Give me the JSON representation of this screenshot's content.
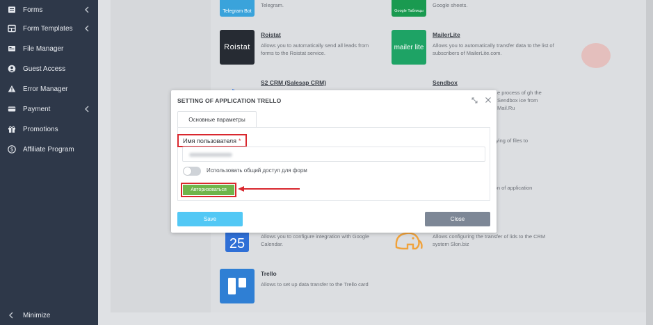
{
  "sidebar": {
    "items": [
      {
        "label": "Forms",
        "icon": "forms-icon",
        "has_submenu": true
      },
      {
        "label": "Form Templates",
        "icon": "templates-icon",
        "has_submenu": true
      },
      {
        "label": "File Manager",
        "icon": "file-manager-icon",
        "has_submenu": false
      },
      {
        "label": "Guest Access",
        "icon": "user-circle-icon",
        "has_submenu": false
      },
      {
        "label": "Error Manager",
        "icon": "warning-icon",
        "has_submenu": false
      },
      {
        "label": "Payment",
        "icon": "payment-icon",
        "has_submenu": true
      },
      {
        "label": "Promotions",
        "icon": "gift-icon",
        "has_submenu": false
      },
      {
        "label": "Affiliate Program",
        "icon": "dollar-icon",
        "has_submenu": false
      }
    ],
    "minimize_label": "Minimize"
  },
  "apps": [
    {
      "name": "",
      "logo_text": "Telegram Bot",
      "desc": "Telegram."
    },
    {
      "name": "",
      "logo_text": "Google Таблицы",
      "desc": "Google sheets."
    },
    {
      "name": "Roistat",
      "logo_text": "Roistat",
      "desc": "Allows you to automatically send all leads from forms to the Roistat service."
    },
    {
      "name": "MailerLite",
      "logo_text": "mailer lite",
      "desc": "Allows you to automatically transfer data to the list of subscribers of MailerLite.com."
    },
    {
      "name": "S2 CRM (Salesap CRM)",
      "logo_text": "",
      "desc": ""
    },
    {
      "name": "Sendbox",
      "logo_text": "",
      "desc": "e process of gh the Sendbox ice from Mail.Ru"
    },
    {
      "name": "",
      "logo_text": "",
      "desc": "pying of files to"
    },
    {
      "name": "",
      "logo_text": "",
      "desc": "ion of application"
    },
    {
      "name": "",
      "logo_text": "25",
      "desc": "Allows you to configure integration with Google Calendar."
    },
    {
      "name": "",
      "logo_text": "",
      "desc": "Allows configuring the transfer of lids to the CRM system Slon.biz"
    },
    {
      "name": "Trello",
      "logo_text": "",
      "desc": "Allows to set up data transfer to the Trello card"
    }
  ],
  "modal": {
    "title": "SETTING OF APPLICATION TRELLO",
    "tab_label": "Основные параметры",
    "username_label": "Имя пользователя",
    "required_mark": "*",
    "toggle_label": "Использовать общий доступ для форм",
    "toggle_on": false,
    "auth_button": "Авторизоваться",
    "save_button": "Save",
    "close_button": "Close"
  },
  "colors": {
    "sidebar_bg": "#2e3849",
    "highlight_red": "#d9272e",
    "auth_green": "#6fb54b",
    "save_blue": "#52c8f5",
    "close_gray": "#7d8796"
  }
}
